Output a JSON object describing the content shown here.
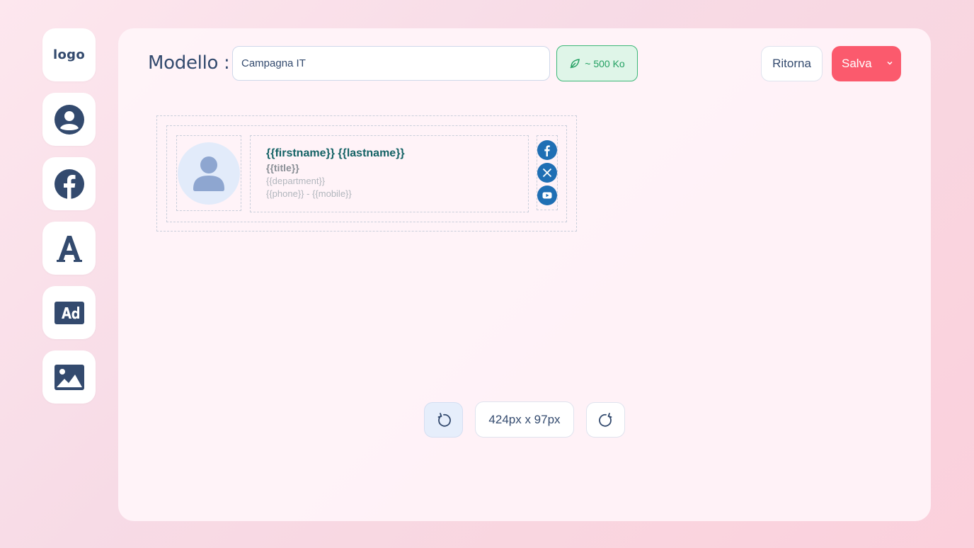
{
  "sidebar": {
    "logo_label": "logo",
    "items": [
      {
        "icon": "user-icon"
      },
      {
        "icon": "facebook-icon"
      },
      {
        "icon": "font-icon"
      },
      {
        "icon": "ad-icon"
      },
      {
        "icon": "image-icon"
      }
    ]
  },
  "header": {
    "title": "Modello :",
    "model_value": "Campagna IT",
    "size_badge": "~ 500 Ko",
    "return_label": "Ritorna",
    "save_label": "Salva"
  },
  "signature": {
    "name": "{{firstname}} {{lastname}}",
    "title": "{{title}}",
    "department": "{{department}}",
    "phone": "{{phone}} - {{mobile}}",
    "socials": [
      "facebook-icon",
      "x-icon",
      "youtube-icon"
    ]
  },
  "toolbar": {
    "dimensions": "424px x 97px"
  },
  "colors": {
    "primary_text": "#334a6e",
    "save_button": "#fb5a6d",
    "badge_green": "#23a062",
    "name_teal": "#146265",
    "social_blue": "#1f6fb4"
  }
}
